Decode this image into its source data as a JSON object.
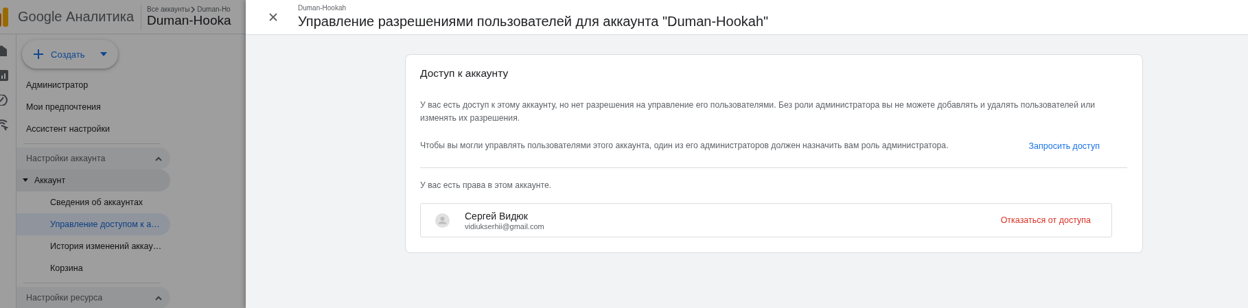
{
  "app": {
    "product": "Google Аналитика",
    "breadcrumb": [
      "Все аккаунты",
      "Duman-Ho"
    ],
    "account": "Duman-Hooka"
  },
  "create_button": {
    "label": "Создать"
  },
  "nav": [
    {
      "label": "Администратор",
      "selected": false
    },
    {
      "label": "Мои предпочтения",
      "selected": false
    },
    {
      "label": "Ассистент настройки",
      "selected": false
    }
  ],
  "sections": [
    {
      "label": "Настройки аккаунта",
      "expanded": true,
      "children": [
        {
          "label": "Аккаунт",
          "expanded": true,
          "children": [
            {
              "label": "Сведения об аккаунтах",
              "selected": false
            },
            {
              "label": "Управление доступом к а…",
              "selected": true
            },
            {
              "label": "История изменений аккау…",
              "selected": false
            },
            {
              "label": "Корзина",
              "selected": false
            }
          ]
        }
      ]
    },
    {
      "label": "Настройки ресурса",
      "expanded": true
    }
  ],
  "dialog": {
    "subtitle": "Duman-Hookah",
    "title": "Управление разрешениями пользователей для аккаунта \"Duman-Hookah\"",
    "card": {
      "title": "Доступ к аккаунту",
      "notice": "У вас есть доступ к этому аккаунту, но нет разрешения на управление его пользователями. Без роли администратора вы не можете добавлять и удалять пользователей или изменять их разрешения.",
      "request_text": "Чтобы вы могли управлять пользователями этого аккаунта, один из его администраторов должен назначить вам роль администратора.",
      "request_link": "Запросить доступ",
      "rights_text": "У вас есть права в этом аккаунте.",
      "users": [
        {
          "name": "Сергей Видюк",
          "email": "vidiukserhii@gmail.com",
          "action": "Отказаться от доступа"
        }
      ]
    }
  }
}
